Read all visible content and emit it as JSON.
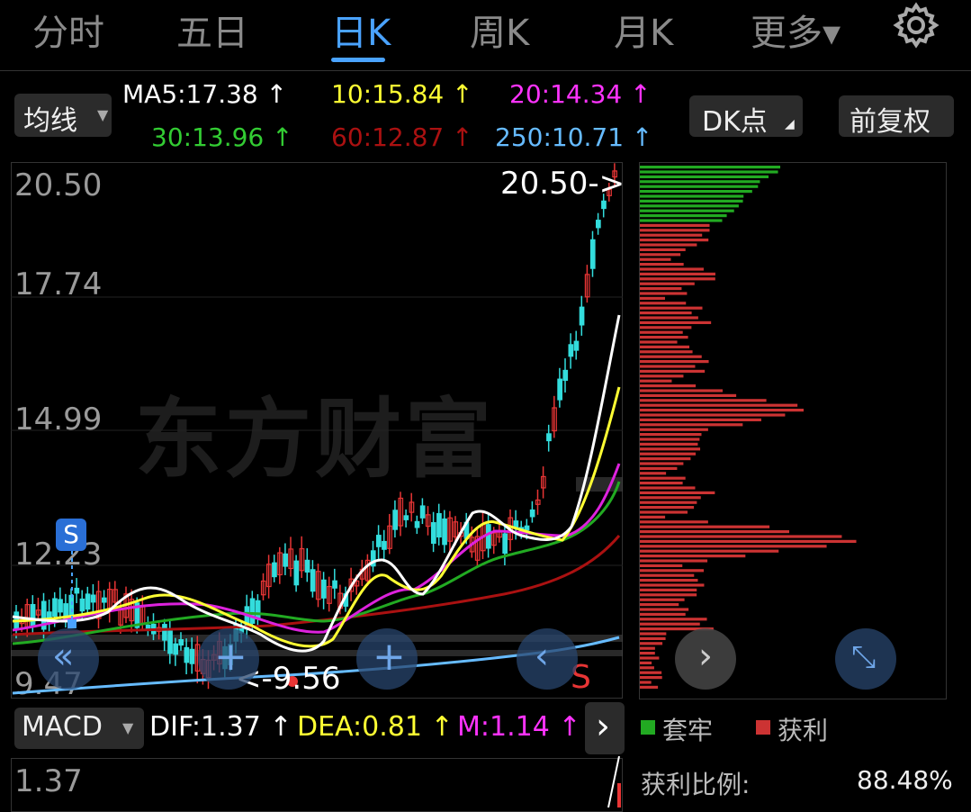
{
  "tabs": [
    {
      "label": "分时",
      "active": false
    },
    {
      "label": "五日",
      "active": false
    },
    {
      "label": "日K",
      "active": true
    },
    {
      "label": "周K",
      "active": false
    },
    {
      "label": "月K",
      "active": false
    },
    {
      "label": "更多▾",
      "active": false
    }
  ],
  "toolbar": {
    "ma_select": "均线",
    "dk_button": "DK点",
    "fq_button": "前复权"
  },
  "ma": [
    {
      "text": "MA5:17.38 ↑",
      "color": "#ffffff"
    },
    {
      "text": "10:15.84 ↑",
      "color": "#ffff33"
    },
    {
      "text": "20:14.34 ↑",
      "color": "#ff33ff"
    },
    {
      "text": "30:13.96 ↑",
      "color": "#33cc33"
    },
    {
      "text": "60:12.87 ↑",
      "color": "#aa1111"
    },
    {
      "text": "250:10.71 ↑",
      "color": "#66bbff"
    }
  ],
  "chart": {
    "y_ticks": [
      "20.50",
      "17.74",
      "14.99",
      "12.23",
      "9.47"
    ],
    "high_label": "20.50->",
    "low_label": "<-9.56",
    "watermark": "东方财富",
    "buy_marker": "S",
    "sell_marker": "S"
  },
  "macd": {
    "select": "MACD",
    "dif": "DIF:1.37 ↑",
    "dea": "DEA:0.81 ↑",
    "m": "M:1.14 ↑",
    "first_tick": "1.37"
  },
  "chip": {
    "legend_trapped": "套牢",
    "legend_profit": "获利",
    "ratio_label": "获利比例:",
    "ratio_value": "88.48%"
  },
  "colors": {
    "up": "#e83535",
    "down": "#33dddd",
    "accent": "#4aa3ff"
  }
}
